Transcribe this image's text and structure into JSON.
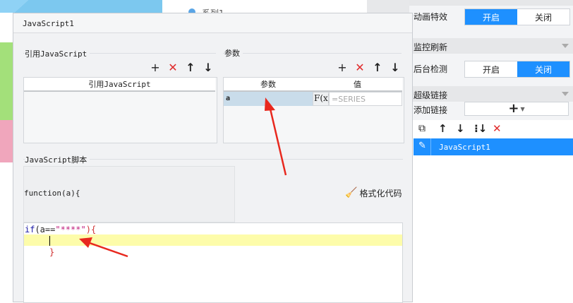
{
  "background": {
    "legend_label": "系列1"
  },
  "right_panel": {
    "animation": {
      "label": "动画特效",
      "on": "开启",
      "off": "关闭",
      "selected": "on"
    },
    "monitor_section": "监控刷新",
    "background_check": {
      "label": "后台检测",
      "on": "开启",
      "off": "关闭",
      "selected": "off"
    },
    "hyperlink_section": "超级链接",
    "add_link": {
      "label": "添加链接",
      "button": "+"
    },
    "link_toolbar": [
      "copy-icon",
      "arrow-up-icon",
      "arrow-down-icon",
      "sort-down-icon",
      "delete-icon"
    ],
    "links": [
      {
        "name": "JavaScript1",
        "icon": "edit-icon",
        "selected": true
      }
    ]
  },
  "dialog": {
    "title": "JavaScript1",
    "ref_section": {
      "label": "引用JavaScript",
      "column": "引用JavaScript",
      "toolbar": [
        "add-icon",
        "delete-icon",
        "arrow-up-icon",
        "arrow-down-icon"
      ]
    },
    "param_section": {
      "label": "参数",
      "columns": [
        "参数",
        "值"
      ],
      "toolbar": [
        "add-icon",
        "delete-icon",
        "arrow-up-icon",
        "arrow-down-icon"
      ],
      "rows": [
        {
          "name": "a",
          "formula_icon": "F(x)",
          "value": "=SERIES"
        }
      ]
    },
    "script_section": {
      "label": "JavaScript脚本",
      "signature": "function(a){",
      "format_button": "格式化代码",
      "code": {
        "line1_kw": "if",
        "line1_mid": "(a==",
        "line1_str": "\"****\"",
        "line1_end": "){",
        "line3": "}"
      }
    }
  },
  "colors": {
    "accent": "#1e90ff",
    "selected_row": "#c9dcea",
    "current_line": "#fdfcaa",
    "annotation": "#e8281e",
    "keyword": "#1a1aa6",
    "string": "#c01f7d"
  }
}
